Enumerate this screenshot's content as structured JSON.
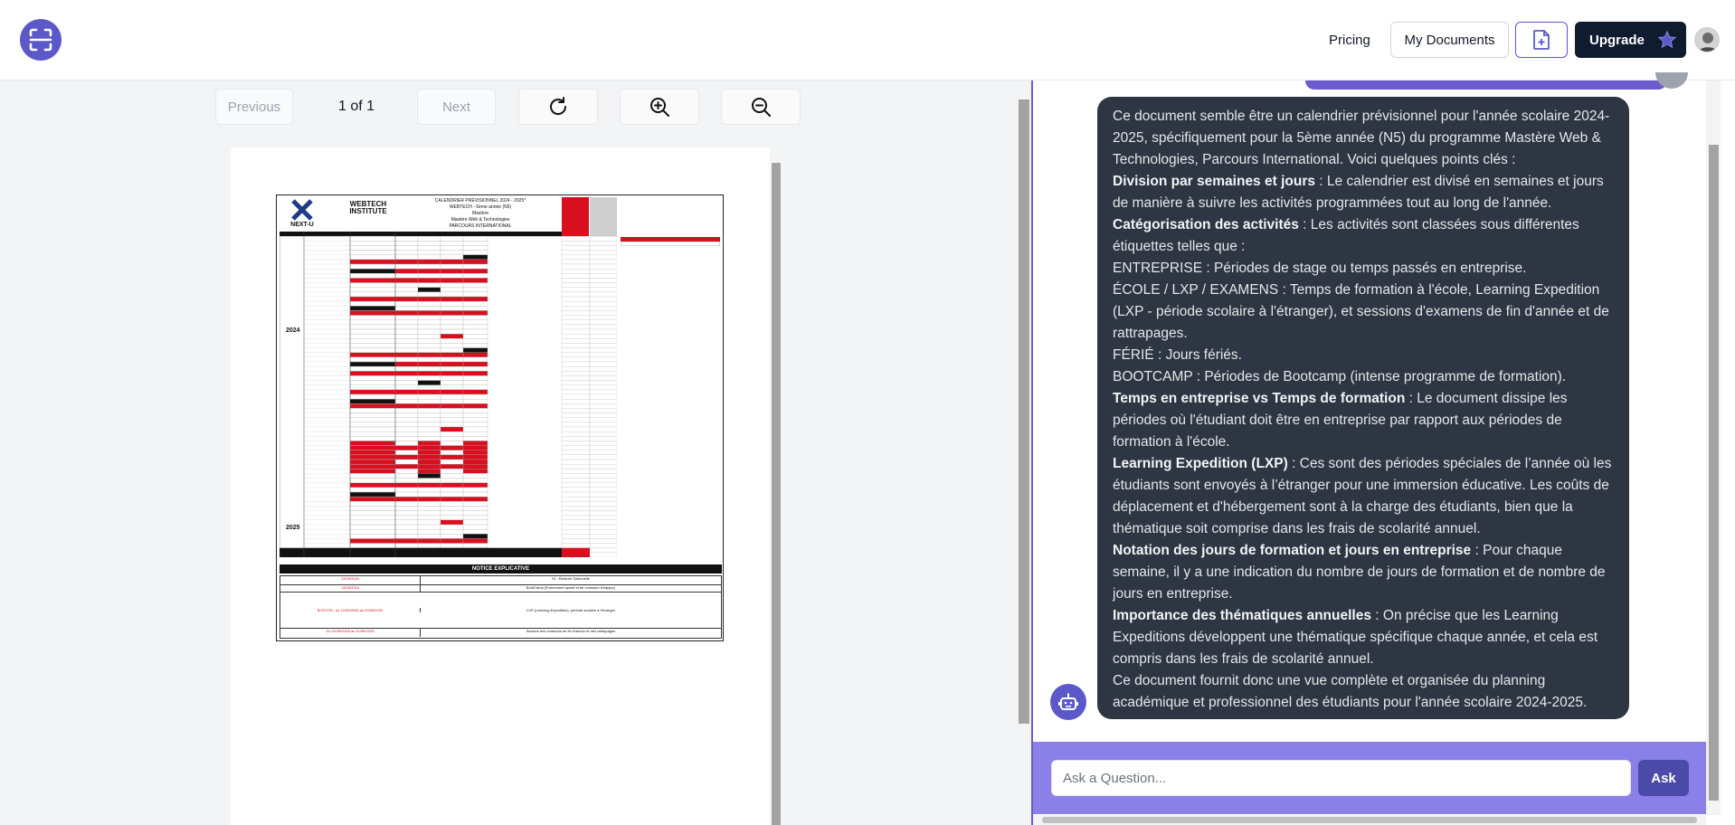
{
  "nav": {
    "pricing": "Pricing",
    "my_documents": "My Documents",
    "upgrade": "Upgrade"
  },
  "viewer": {
    "previous": "Previous",
    "next": "Next",
    "page_indicator": "1 of 1"
  },
  "document": {
    "logo_next": "NEXT-U",
    "logo_webtech": "WEBTECH INSTITUTE",
    "title_lines": [
      "CALENDRIER PRÉVISIONNEL 2024 - 2025*",
      "WEBTECH - 5ème année (N5)",
      "Mastère",
      "Mastère Web & Technologies",
      "PARCOURS INTERNATIONAL"
    ],
    "year_2024": "2024",
    "year_2025": "2025",
    "notice_title": "NOTICE EXPLICATIVE",
    "notice_rows": [
      {
        "left": "12/09/2024",
        "right": "01 : Rentrée Solennelle"
      },
      {
        "left": "12/09/2024",
        "right": "BootCamp (Evènement sportif et de cohésion d'équipe)"
      },
      {
        "left": "BOSTON : du 12/05/2025 au 29/06/2025",
        "right": "LXP (Learning Expedition), période scolaire à l'étranger"
      },
      {
        "left": "Du 02/06/2025 au 11/06/2025",
        "right": "Session des examens de fin d'année et des rattrapages"
      }
    ]
  },
  "chat": {
    "paragraphs": [
      {
        "bold": "",
        "text": "Ce document semble être un calendrier prévisionnel pour l'année scolaire 2024-2025, spécifiquement pour la 5ème année (N5) du programme Mastère Web & Technologies, Parcours International. Voici quelques points clés :"
      },
      {
        "bold": "Division par semaines et jours",
        "text": " : Le calendrier est divisé en semaines et jours de manière à suivre les activités programmées tout au long de l'année."
      },
      {
        "bold": "Catégorisation des activités",
        "text": " : Les activités sont classées sous différentes étiquettes telles que :"
      },
      {
        "bold": "",
        "text": "ENTREPRISE : Périodes de stage ou temps passés en entreprise."
      },
      {
        "bold": "",
        "text": "ÉCOLE / LXP / EXAMENS : Temps de formation à l'école, Learning Expedition (LXP - période scolaire à l'étranger), et sessions d'examens de fin d'année et de rattrapages."
      },
      {
        "bold": "",
        "text": "FÉRIÉ : Jours fériés."
      },
      {
        "bold": "",
        "text": "BOOTCAMP : Périodes de Bootcamp (intense programme de formation)."
      },
      {
        "bold": "Temps en entreprise vs Temps de formation",
        "text": " : Le document dissipe les périodes où l'étudiant doit être en entreprise par rapport aux périodes de formation à l'école."
      },
      {
        "bold": "Learning Expedition (LXP)",
        "text": " : Ces sont des périodes spéciales de l’année où les étudiants sont envoyés à l’étranger pour une immersion éducative. Les coûts de déplacement et d'hébergement sont à la charge des étudiants, bien que la thématique soit comprise dans les frais de scolarité annuel."
      },
      {
        "bold": "Notation des jours de formation et jours en entreprise",
        "text": " : Pour chaque semaine, il y a une indication du nombre de jours de formation et de nombre de jours en entreprise."
      },
      {
        "bold": "Importance des thématiques annuelles",
        "text": " : On précise que les Learning Expeditions développent une thématique spécifique chaque année, et cela est compris dans les frais de scolarité annuel."
      },
      {
        "bold": "",
        "text": "Ce document fournit donc une vue complète et organisée du planning académique et professionnel des étudiants pour l'année scolaire 2024-2025."
      }
    ],
    "input_placeholder": "Ask a Question...",
    "ask_button": "Ask"
  },
  "colors": {
    "brand": "#5b59c9",
    "upgrade_bg": "#0f1b2e",
    "bot_bubble": "#2d3642",
    "input_bar": "#8b7fe8",
    "doc_red": "#d80f1f"
  },
  "icons": {
    "logo": "scan-icon",
    "new_document": "file-plus-icon",
    "upgrade": "star-icon",
    "refresh": "refresh-icon",
    "zoom_in": "zoom-in-icon",
    "zoom_out": "zoom-out-icon",
    "bot": "robot-icon"
  }
}
